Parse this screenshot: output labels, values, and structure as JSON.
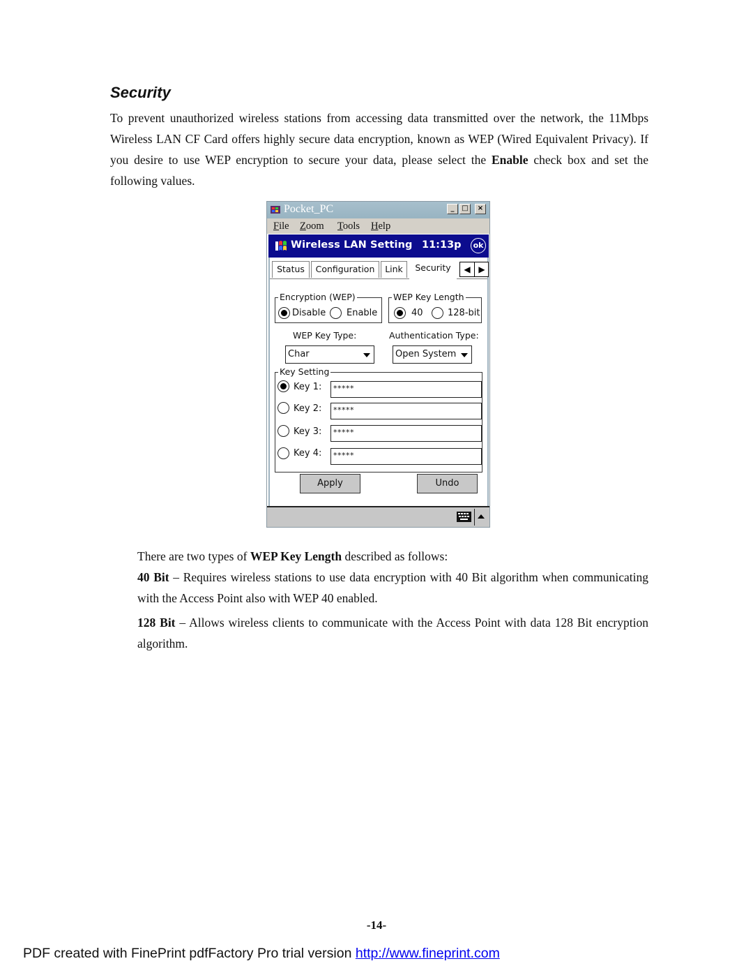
{
  "section": {
    "heading": "Security",
    "intro_text": "To prevent unauthorized wireless stations from accessing data transmitted over the network, the 11Mbps Wireless LAN CF Card offers highly secure data encryption, known as WEP (Wired Equivalent Privacy).   If you desire to use WEP encryption to secure your data, please select the ",
    "intro_bold": "Enable",
    "intro_tail": " check box and set the following values."
  },
  "screenshot": {
    "window_title": "Pocket_PC",
    "window_buttons": {
      "minimize": "_",
      "maximize": "□",
      "close": "×"
    },
    "menu": [
      {
        "accel": "F",
        "rest": "ile"
      },
      {
        "accel": "Z",
        "rest": "oom"
      },
      {
        "accel": "T",
        "rest": "ools"
      },
      {
        "accel": "H",
        "rest": "elp"
      }
    ],
    "nav_bar": {
      "title": "Wireless LAN Setting",
      "time": "11:13p",
      "ok_label": "ok",
      "color": "#0c0c8e"
    },
    "tabs": [
      {
        "label": "Status",
        "active": false
      },
      {
        "label": "Configuration",
        "active": false
      },
      {
        "label": "Link",
        "active": false
      },
      {
        "label": "Security",
        "active": true
      }
    ],
    "tab_scroll": {
      "left": "◀",
      "right": "▶"
    },
    "encryption": {
      "group_label": "Encryption (WEP)",
      "options": [
        "Disable",
        "Enable"
      ],
      "selected": "Disable"
    },
    "key_length": {
      "group_label": "WEP Key Length",
      "options": [
        "40",
        "128-bit"
      ],
      "selected": "40"
    },
    "key_type": {
      "label": "WEP Key Type:",
      "value": "Char"
    },
    "auth_type": {
      "label": "Authentication Type:",
      "value": "Open System"
    },
    "key_setting": {
      "group_label": "Key Setting",
      "keys": [
        {
          "label": "Key 1:",
          "value": "*****",
          "selected": true
        },
        {
          "label": "Key 2:",
          "value": "*****",
          "selected": false
        },
        {
          "label": "Key 3:",
          "value": "*****",
          "selected": false
        },
        {
          "label": "Key 4:",
          "value": "*****",
          "selected": false
        }
      ]
    },
    "buttons": {
      "apply": "Apply",
      "undo": "Undo"
    }
  },
  "key_length_text": {
    "intro_pre": "There are two types of ",
    "intro_bold": "WEP Key Length",
    "intro_post": " described as follows:",
    "bit40_bold": "40 Bit",
    "bit40_text": " – Requires wireless stations to use data encryption with 40 Bit algorithm when communicating with the Access Point also with WEP 40 enabled.",
    "bit128_bold": "128 Bit",
    "bit128_text": " – Allows wireless clients to communicate with the Access Point with data 128 Bit encryption algorithm."
  },
  "page_number": "-14-",
  "footer": {
    "text": "PDF created with FinePrint pdfFactory Pro trial version ",
    "link": "http://www.fineprint.com"
  }
}
